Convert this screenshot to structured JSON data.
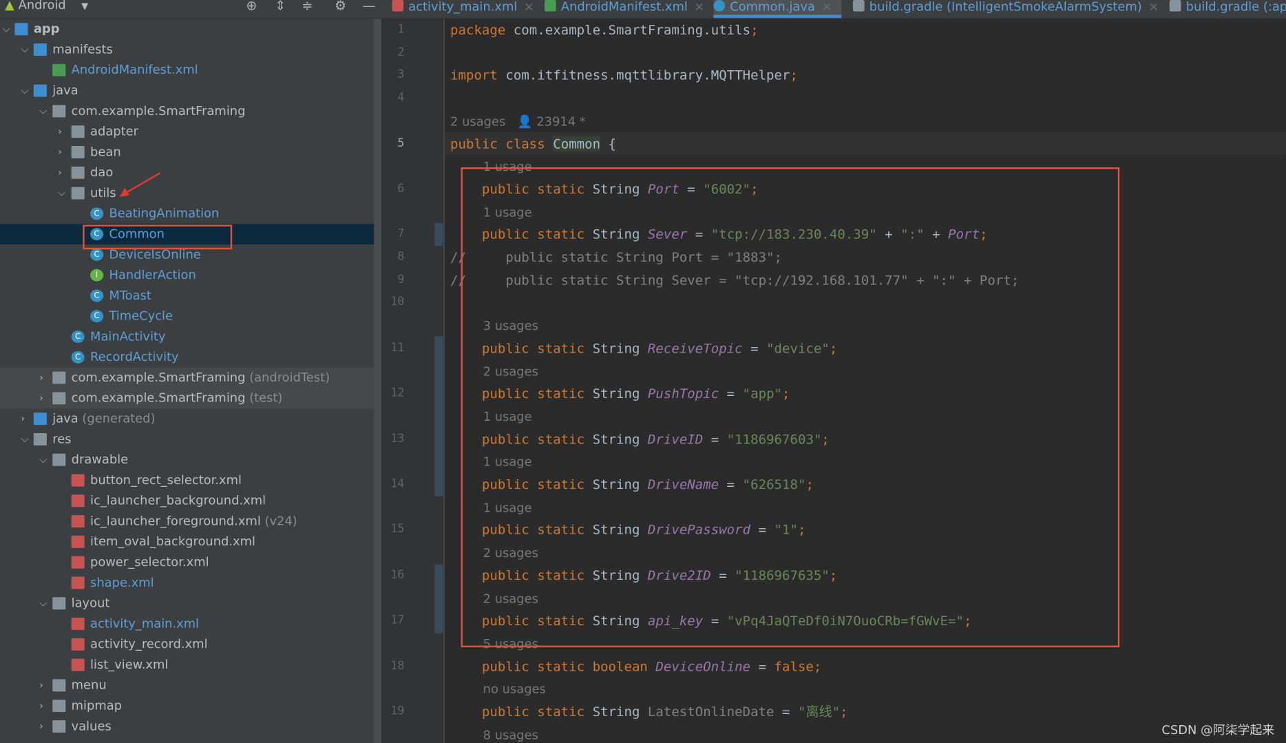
{
  "topbar": {
    "project_view": "Android",
    "icons": [
      "crosshair-icon",
      "expand-all-icon",
      "collapse-all-icon",
      "gear-icon",
      "minimize-icon"
    ]
  },
  "tabs": [
    {
      "label": "activity_main.xml",
      "icon": "xml-icon",
      "active": false
    },
    {
      "label": "AndroidManifest.xml",
      "icon": "manifest-icon",
      "active": false
    },
    {
      "label": "Common.java",
      "icon": "class-icon",
      "active": true
    },
    {
      "label": "build.gradle (IntelligentSmokeAlarmSystem)",
      "icon": "gradle-icon",
      "active": false
    },
    {
      "label": "build.gradle (:ap",
      "icon": "gradle-icon",
      "active": false
    }
  ],
  "tree": [
    {
      "label": "app",
      "level": 0,
      "arrow": "open",
      "icon": "folderb",
      "bold": true
    },
    {
      "label": "manifests",
      "level": 1,
      "arrow": "open",
      "icon": "folderb"
    },
    {
      "label": "AndroidManifest.xml",
      "level": 2,
      "icon": "mf",
      "blue": true
    },
    {
      "label": "java",
      "level": 1,
      "arrow": "open",
      "icon": "folderb"
    },
    {
      "label": "com.example.SmartFraming",
      "level": 2,
      "arrow": "open",
      "icon": "folder"
    },
    {
      "label": "adapter",
      "level": 3,
      "arrow": "closed",
      "icon": "folder"
    },
    {
      "label": "bean",
      "level": 3,
      "arrow": "closed",
      "icon": "folder"
    },
    {
      "label": "dao",
      "level": 3,
      "arrow": "closed",
      "icon": "folder"
    },
    {
      "label": "utils",
      "level": 3,
      "arrow": "open",
      "icon": "folder"
    },
    {
      "label": "BeatingAnimation",
      "level": 4,
      "icon": "cls",
      "blue": true
    },
    {
      "label": "Common",
      "level": 4,
      "icon": "cls",
      "blue": true,
      "selected": true
    },
    {
      "label": "DeviceIsOnline",
      "level": 4,
      "icon": "cls",
      "blue": true
    },
    {
      "label": "HandlerAction",
      "level": 4,
      "icon": "intf",
      "blue": true
    },
    {
      "label": "MToast",
      "level": 4,
      "icon": "cls",
      "blue": true
    },
    {
      "label": "TimeCycle",
      "level": 4,
      "icon": "cls",
      "blue": true
    },
    {
      "label": "MainActivity",
      "level": 3,
      "icon": "cls",
      "blue": true
    },
    {
      "label": "RecordActivity",
      "level": 3,
      "icon": "cls",
      "blue": true
    },
    {
      "label": "com.example.SmartFraming",
      "suffix": " (androidTest)",
      "level": 2,
      "arrow": "closed",
      "icon": "folder",
      "test": true
    },
    {
      "label": "com.example.SmartFraming",
      "suffix": " (test)",
      "level": 2,
      "arrow": "closed",
      "icon": "folder",
      "test": true
    },
    {
      "label": "java",
      "suffix": " (generated)",
      "level": 1,
      "arrow": "closed",
      "icon": "folderb"
    },
    {
      "label": "res",
      "level": 1,
      "arrow": "open",
      "icon": "folder"
    },
    {
      "label": "drawable",
      "level": 2,
      "arrow": "open",
      "icon": "folder"
    },
    {
      "label": "button_rect_selector.xml",
      "level": 3,
      "icon": "xml"
    },
    {
      "label": "ic_launcher_background.xml",
      "level": 3,
      "icon": "xml"
    },
    {
      "label": "ic_launcher_foreground.xml",
      "suffix": " (v24)",
      "level": 3,
      "icon": "xml"
    },
    {
      "label": "item_oval_background.xml",
      "level": 3,
      "icon": "xml"
    },
    {
      "label": "power_selector.xml",
      "level": 3,
      "icon": "xml"
    },
    {
      "label": "shape.xml",
      "level": 3,
      "icon": "xml",
      "blue": true
    },
    {
      "label": "layout",
      "level": 2,
      "arrow": "open",
      "icon": "folder"
    },
    {
      "label": "activity_main.xml",
      "level": 3,
      "icon": "xml",
      "blue": true
    },
    {
      "label": "activity_record.xml",
      "level": 3,
      "icon": "xml"
    },
    {
      "label": "list_view.xml",
      "level": 3,
      "icon": "xml"
    },
    {
      "label": "menu",
      "level": 2,
      "arrow": "closed",
      "icon": "folder"
    },
    {
      "label": "mipmap",
      "level": 2,
      "arrow": "closed",
      "icon": "folder"
    },
    {
      "label": "values",
      "level": 2,
      "arrow": "closed",
      "icon": "folder"
    }
  ],
  "editor": {
    "rows": [
      {
        "ln": "1",
        "tokens": [
          [
            "package ",
            "kw"
          ],
          [
            "com.example.SmartFraming.utils",
            ""
          ],
          [
            ";",
            "kw"
          ]
        ]
      },
      {
        "ln": "2",
        "tokens": []
      },
      {
        "ln": "3",
        "tokens": [
          [
            "import ",
            "kw"
          ],
          [
            "com.itfitness.mqttlibrary.MQTTHelper",
            ""
          ],
          [
            ";",
            "kw"
          ]
        ]
      },
      {
        "ln": "4",
        "tokens": []
      },
      {
        "hint": "2 usages   👤 23914 *",
        "indent": 0
      },
      {
        "ln": "5",
        "cur": true,
        "tokens": [
          [
            "public class ",
            "kw"
          ],
          [
            "Common",
            "cls-hl"
          ],
          [
            " {",
            ""
          ]
        ]
      },
      {
        "hint": "1 usage",
        "indent": 1
      },
      {
        "ln": "6",
        "tokens": [
          [
            "    public static ",
            "kw"
          ],
          [
            "String ",
            ""
          ],
          [
            "Port",
            "fd"
          ],
          [
            " = ",
            ""
          ],
          [
            "\"6002\"",
            "st"
          ],
          [
            ";",
            "kw"
          ]
        ]
      },
      {
        "hint": "1 usage",
        "indent": 1
      },
      {
        "ln": "7",
        "tokens": [
          [
            "    public static ",
            "kw"
          ],
          [
            "String ",
            ""
          ],
          [
            "Sever",
            "fd"
          ],
          [
            " = ",
            ""
          ],
          [
            "\"tcp://183.230.40.39\"",
            "st"
          ],
          [
            " + ",
            ""
          ],
          [
            "\":\"",
            "st"
          ],
          [
            " + ",
            ""
          ],
          [
            "Port",
            "fd"
          ],
          [
            ";",
            "kw"
          ]
        ]
      },
      {
        "ln": "8",
        "tokens": [
          [
            "//     public static String Port = \"1883\";",
            "cm"
          ]
        ]
      },
      {
        "ln": "9",
        "tokens": [
          [
            "//     public static String Sever = \"tcp://192.168.101.77\" + \":\" + Port;",
            "cm"
          ]
        ]
      },
      {
        "ln": "10",
        "tokens": []
      },
      {
        "hint": "3 usages",
        "indent": 1
      },
      {
        "ln": "11",
        "tokens": [
          [
            "    public static ",
            "kw"
          ],
          [
            "String ",
            ""
          ],
          [
            "ReceiveTopic",
            "fd"
          ],
          [
            " = ",
            ""
          ],
          [
            "\"device\"",
            "st"
          ],
          [
            ";",
            "kw"
          ]
        ]
      },
      {
        "hint": "2 usages",
        "indent": 1
      },
      {
        "ln": "12",
        "tokens": [
          [
            "    public static ",
            "kw"
          ],
          [
            "String ",
            ""
          ],
          [
            "PushTopic",
            "fd"
          ],
          [
            " = ",
            ""
          ],
          [
            "\"app\"",
            "st"
          ],
          [
            ";",
            "kw"
          ]
        ]
      },
      {
        "hint": "1 usage",
        "indent": 1
      },
      {
        "ln": "13",
        "tokens": [
          [
            "    public static ",
            "kw"
          ],
          [
            "String ",
            ""
          ],
          [
            "DriveID",
            "fd"
          ],
          [
            " = ",
            ""
          ],
          [
            "\"1186967603\"",
            "st"
          ],
          [
            ";",
            "kw"
          ]
        ]
      },
      {
        "hint": "1 usage",
        "indent": 1
      },
      {
        "ln": "14",
        "tokens": [
          [
            "    public static ",
            "kw"
          ],
          [
            "String ",
            ""
          ],
          [
            "DriveName",
            "fd"
          ],
          [
            " = ",
            ""
          ],
          [
            "\"626518\"",
            "st"
          ],
          [
            ";",
            "kw"
          ]
        ]
      },
      {
        "hint": "1 usage",
        "indent": 1
      },
      {
        "ln": "15",
        "tokens": [
          [
            "    public static ",
            "kw"
          ],
          [
            "String ",
            ""
          ],
          [
            "DrivePassword",
            "fd"
          ],
          [
            " = ",
            ""
          ],
          [
            "\"1\"",
            "st"
          ],
          [
            ";",
            "kw"
          ]
        ]
      },
      {
        "hint": "2 usages",
        "indent": 1
      },
      {
        "ln": "16",
        "tokens": [
          [
            "    public static ",
            "kw"
          ],
          [
            "String ",
            ""
          ],
          [
            "Drive2ID",
            "fd"
          ],
          [
            " = ",
            ""
          ],
          [
            "\"1186967635\"",
            "st"
          ],
          [
            ";",
            "kw"
          ]
        ]
      },
      {
        "hint": "2 usages",
        "indent": 1
      },
      {
        "ln": "17",
        "tokens": [
          [
            "    public static ",
            "kw"
          ],
          [
            "String ",
            ""
          ],
          [
            "api_key",
            "fd"
          ],
          [
            " = ",
            ""
          ],
          [
            "\"vPq4JaQTeDf0iN7OuoCRb=fGWvE=\"",
            "st"
          ],
          [
            ";",
            "kw"
          ]
        ]
      },
      {
        "hint": "5 usages",
        "indent": 1
      },
      {
        "ln": "18",
        "tokens": [
          [
            "    public static boolean ",
            "kw"
          ],
          [
            "DeviceOnline",
            "fd"
          ],
          [
            " = ",
            ""
          ],
          [
            "false",
            "kw"
          ],
          [
            ";",
            "kw"
          ]
        ]
      },
      {
        "hint": "no usages",
        "indent": 1
      },
      {
        "ln": "19",
        "tokens": [
          [
            "    public static ",
            "kw"
          ],
          [
            "String ",
            ""
          ],
          [
            "LatestOnlineDate",
            "cm"
          ],
          [
            " = ",
            ""
          ],
          [
            "\"离线\"",
            "st"
          ],
          [
            ";",
            "kw"
          ]
        ]
      },
      {
        "hint": "8 usages",
        "indent": 1
      }
    ]
  },
  "watermark": "CSDN @阿柒学起来",
  "colors": {
    "keyword": "#cc7832",
    "string": "#6a8759",
    "field": "#9876aa",
    "highlight_box": "#e0533b",
    "selection": "#0d293e"
  }
}
